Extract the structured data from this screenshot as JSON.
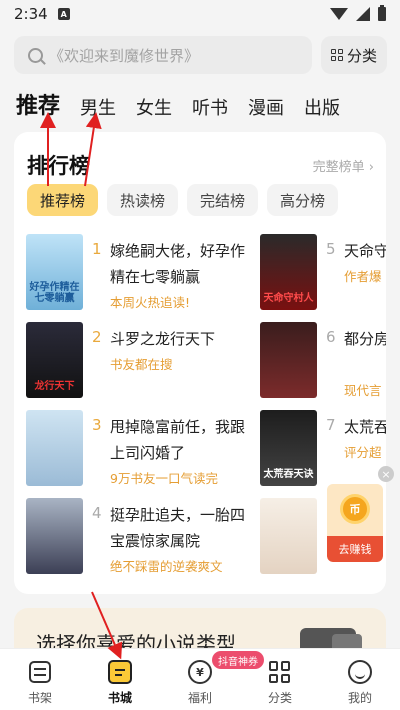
{
  "status": {
    "time": "2:34",
    "notif_badge": "A"
  },
  "search": {
    "placeholder": "《欢迎来到魔修世界》",
    "category_label": "分类"
  },
  "top_tabs": [
    "推荐",
    "男生",
    "女生",
    "听书",
    "漫画",
    "出版"
  ],
  "ranking": {
    "title": "排行榜",
    "more": "完整榜单 ›",
    "tabs": [
      "推荐榜",
      "热读榜",
      "完结榜",
      "高分榜"
    ],
    "books_left": [
      {
        "rank": "1",
        "title": "嫁绝嗣大佬，好孕作精在七零躺赢",
        "tag": "本周火热追读!"
      },
      {
        "rank": "2",
        "title": "斗罗之龙行天下",
        "tag": "书友都在搜"
      },
      {
        "rank": "3",
        "title": "甩掉隐富前任，我跟上司闪婚了",
        "tag": "9万书友一口气读完"
      },
      {
        "rank": "4",
        "title": "挺孕肚追夫，一胎四宝震惊家属院",
        "tag": "绝不踩雷的逆袭爽文"
      }
    ],
    "books_right": [
      {
        "rank": "5",
        "title": "天命守",
        "tag": "作者爆"
      },
      {
        "rank": "6",
        "title": "都分房禁欲大",
        "tag": "现代言"
      },
      {
        "rank": "7",
        "title": "太荒吞",
        "tag": "评分超"
      },
      {
        "rank": "8",
        "title": "",
        "tag": ""
      }
    ],
    "cover_texts": {
      "c1": "好孕作精在七零躺赢",
      "c2": "龙行天下",
      "c3": "",
      "c4": "",
      "c5": "天命守村人",
      "c6": "",
      "c7": "太荒吞天诀",
      "c8": ""
    }
  },
  "float_reward": {
    "label": "去赚钱",
    "coin": "币"
  },
  "preference": {
    "title": "选择你喜爱的小说类型"
  },
  "bottom_nav": [
    {
      "label": "书架"
    },
    {
      "label": "书城"
    },
    {
      "label": "福利",
      "badge": "抖音神券"
    },
    {
      "label": "分类"
    },
    {
      "label": "我的"
    }
  ],
  "colors": {
    "accent": "#fcd777",
    "tag": "#e59e34",
    "arrow": "#e02020"
  }
}
